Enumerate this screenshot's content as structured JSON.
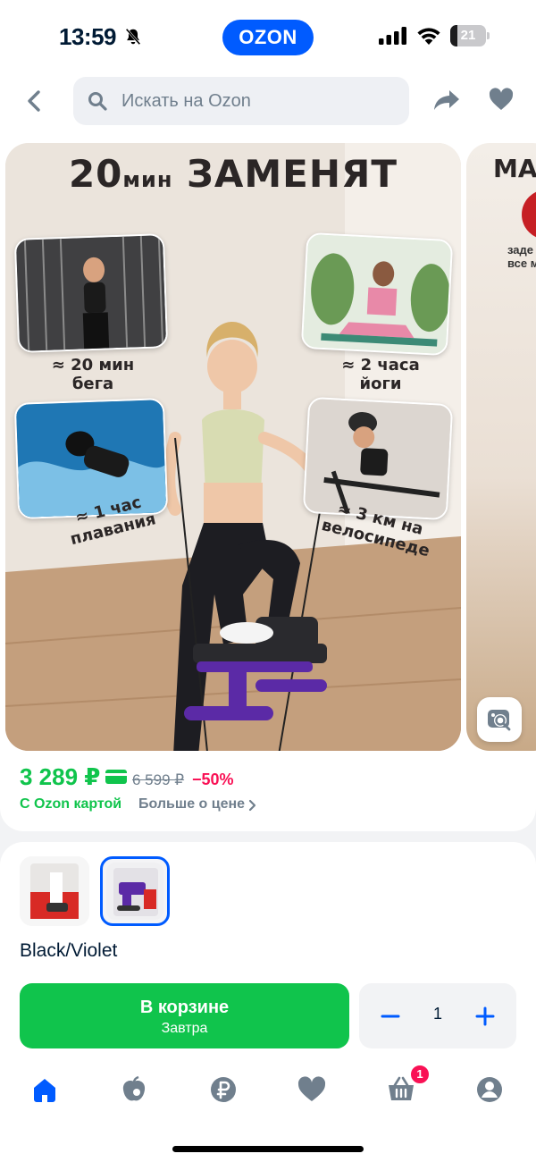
{
  "status_bar": {
    "time": "13:59",
    "battery": "21",
    "battery_level": 0.21
  },
  "app": {
    "logo_text": "OZON",
    "brand_color": "#005bff"
  },
  "search": {
    "placeholder": "Искать на Ozon"
  },
  "gallery": {
    "slide1": {
      "title_num": "20",
      "title_unit": "мин",
      "title_word": "ЗАМЕНЯТ",
      "captions": [
        "≈ 20 мин бега",
        "≈ 2 часа йоги",
        "≈ 1 час плавания",
        "≈ 3 км на велосипеде"
      ]
    },
    "slide2": {
      "title": "МА",
      "text": "заде все м"
    }
  },
  "price": {
    "current": "3 289 ₽",
    "old": "6 599 ₽",
    "discount": "−50%",
    "card_label": "С Ozon картой",
    "more_label": "Больше о цене",
    "accent_color": "#10c44c",
    "discount_color": "#f91155"
  },
  "variants": {
    "selected_label": "Black/Violet",
    "items": [
      {
        "name": "variant-red",
        "selected": false
      },
      {
        "name": "variant-black-violet",
        "selected": true
      }
    ]
  },
  "cart": {
    "button_label": "В корзине",
    "button_sub": "Завтра",
    "quantity": "1"
  },
  "bottom_nav": {
    "items": [
      "home-icon",
      "fresh-icon",
      "finance-icon",
      "favorites-icon",
      "cart-icon",
      "profile-icon"
    ],
    "cart_badge": "1"
  }
}
